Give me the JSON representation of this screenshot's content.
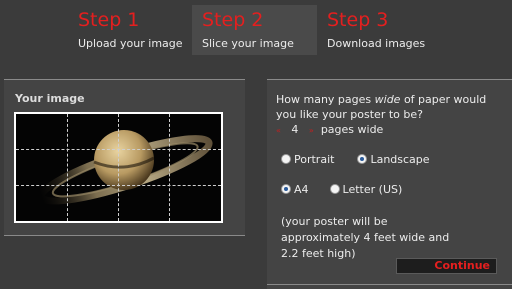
{
  "steps": [
    {
      "title": "Step 1",
      "subtitle": "Upload your image"
    },
    {
      "title": "Step 2",
      "subtitle": "Slice your image"
    },
    {
      "title": "Step 3",
      "subtitle": "Download images"
    }
  ],
  "left_panel": {
    "title": "Your image"
  },
  "right_panel": {
    "question_line1": "How many pages ",
    "question_emph": "wide",
    "question_line2": " of paper would you like your poster to be?",
    "count_prev": "«",
    "count_value": "4",
    "count_next": "»",
    "count_suffix": "pages wide",
    "orientation": {
      "portrait": "Portrait",
      "landscape": "Landscape",
      "selected": "Landscape"
    },
    "paper": {
      "a4": "A4",
      "letter": "Letter (US)",
      "selected": "A4"
    },
    "note": "(your poster will be approximately 4 feet wide and 2.2 feet high)",
    "continue_label": "Continue"
  },
  "colors": {
    "accent": "#e41f1f",
    "background": "#3b3b3b",
    "panel": "#444444"
  }
}
